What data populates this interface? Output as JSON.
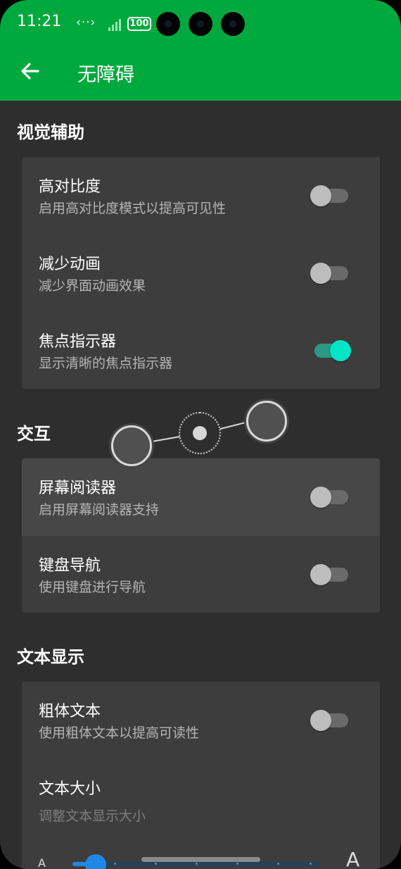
{
  "status_bar": {
    "time": "11:21",
    "signal_text": "‹··›",
    "battery": "100"
  },
  "app_bar": {
    "title": "无障碍",
    "back_icon": "arrow-left-icon"
  },
  "sections": {
    "visual": "视觉辅助",
    "interaction": "交互",
    "text": "文本显示"
  },
  "visual_items": [
    {
      "label": "高对比度",
      "sub": "启用高对比度模式以提高可见性",
      "on": false
    },
    {
      "label": "减少动画",
      "sub": "减少界面动画效果",
      "on": false
    },
    {
      "label": "焦点指示器",
      "sub": "显示清晰的焦点指示器",
      "on": true
    }
  ],
  "interaction_items": [
    {
      "label": "屏幕阅读器",
      "sub": "启用屏幕阅读器支持",
      "on": false
    },
    {
      "label": "键盘导航",
      "sub": "使用键盘进行导航",
      "on": false
    }
  ],
  "text_items": [
    {
      "label": "粗体文本",
      "sub": "使用粗体文本以提高可读性",
      "on": false
    }
  ],
  "text_size": {
    "label": "文本大小",
    "sub": "调整文本显示大小",
    "min_label": "A",
    "max_label": "A",
    "value_fraction": 0.09
  },
  "colors": {
    "accent": "#00a93e",
    "toggle_on": "#00e5c8",
    "slider": "#1e88e5"
  }
}
